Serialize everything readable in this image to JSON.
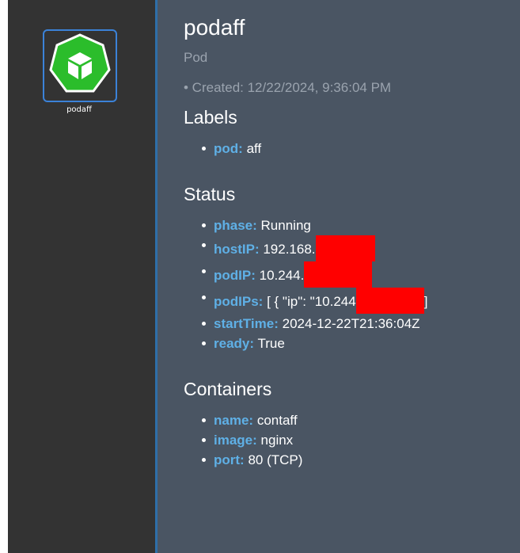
{
  "node": {
    "label": "podaff",
    "icon": "pod-cube-icon",
    "icon_color": "#2bbd2b",
    "selected_border": "#3b82d8"
  },
  "details": {
    "title": "podaff",
    "kind": "Pod",
    "created": "• Created: 12/22/2024, 9:36:04 PM",
    "labels": {
      "heading": "Labels",
      "items": [
        {
          "key": "pod:",
          "value": "aff"
        }
      ]
    },
    "status": {
      "heading": "Status",
      "items": [
        {
          "key": "phase:",
          "value": "Running"
        },
        {
          "key": "hostIP:",
          "value": "192.168."
        },
        {
          "key": "podIP:",
          "value": "10.244."
        },
        {
          "key": "podIPs:",
          "value": "[ { \"ip\": \"10.244",
          "suffix": "]"
        },
        {
          "key": "startTime:",
          "value": "2024-12-22T21:36:04Z"
        },
        {
          "key": "ready:",
          "value": "True"
        }
      ]
    },
    "containers": {
      "heading": "Containers",
      "items": [
        {
          "key": "name:",
          "value": "contaff"
        },
        {
          "key": "image:",
          "value": "nginx"
        },
        {
          "key": "port:",
          "value": "80 (TCP)"
        }
      ]
    }
  },
  "colors": {
    "canvas_bg": "#333333",
    "panel_bg": "#4a5563",
    "key_color": "#5fb0e6",
    "muted_text": "#9aa3ae",
    "redaction": "#ff0000"
  }
}
